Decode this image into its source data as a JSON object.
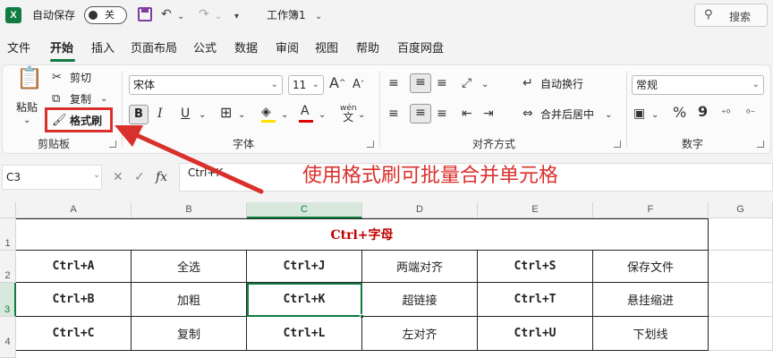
{
  "titlebar": {
    "logo": "X",
    "autosave_label": "自动保存",
    "autosave_state": "关",
    "title": "工作簿1",
    "search_label": "搜索"
  },
  "menu": [
    "文件",
    "开始",
    "插入",
    "页面布局",
    "公式",
    "数据",
    "审阅",
    "视图",
    "帮助",
    "百度网盘"
  ],
  "ribbon": {
    "clipboard": {
      "paste": "粘贴",
      "cut": "剪切",
      "copy": "复制",
      "format_painter": "格式刷",
      "label": "剪贴板"
    },
    "font": {
      "name": "宋体",
      "size": "11",
      "grow": "A",
      "shrink": "A",
      "bold": "B",
      "italic": "I",
      "underline": "U",
      "color_letter": "A",
      "phonetic": "wén",
      "label": "字体"
    },
    "alignment": {
      "wrap": "自动换行",
      "merge": "合并后居中",
      "label": "对齐方式"
    },
    "number": {
      "format": "常规",
      "percent": "%",
      "comma": "9",
      "label": "数字"
    }
  },
  "formula_bar": {
    "name_box": "C3",
    "fx": "fx",
    "content": "Ctrl+K"
  },
  "annotation": "使用格式刷可批量合并单元格",
  "accent_color": "#107c41",
  "annotation_color": "#d9302c",
  "sheet": {
    "columns": [
      "A",
      "B",
      "C",
      "D",
      "E",
      "F",
      "G"
    ],
    "rows": [
      "1",
      "2",
      "3",
      "4"
    ],
    "title": "Ctrl+字母",
    "data": [
      [
        "Ctrl+A",
        "全选",
        "Ctrl+J",
        "两端对齐",
        "Ctrl+S",
        "保存文件"
      ],
      [
        "Ctrl+B",
        "加粗",
        "Ctrl+K",
        "超链接",
        "Ctrl+T",
        "悬挂缩进"
      ],
      [
        "Ctrl+C",
        "复制",
        "Ctrl+L",
        "左对齐",
        "Ctrl+U",
        "下划线"
      ]
    ],
    "active_cell": "C3"
  }
}
